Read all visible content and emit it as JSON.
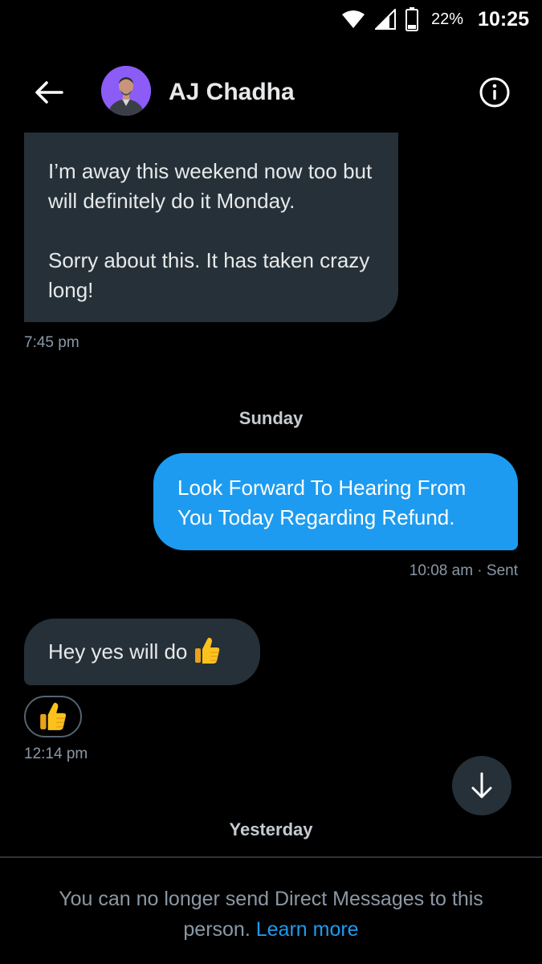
{
  "status_bar": {
    "battery_percent": "22%",
    "time": "10:25",
    "icons": [
      "wifi-icon",
      "cell-signal-icon",
      "battery-icon"
    ]
  },
  "header": {
    "contact_name": "AJ Chadha",
    "back_icon": "arrow-left-icon",
    "info_icon": "info-circle-icon"
  },
  "messages": [
    {
      "direction": "incoming",
      "paragraphs": [
        "I’m away this weekend now too but will definitely do it Monday.",
        "Sorry about this. It has taken crazy long!"
      ],
      "time": "7:45 pm"
    },
    {
      "type": "day_separator",
      "label": "Sunday"
    },
    {
      "direction": "outgoing",
      "text": "Look Forward To Hearing From You Today Regarding Refund.",
      "time": "10:08 am · Sent"
    },
    {
      "direction": "incoming",
      "text": "Hey yes will do",
      "emoji": "thumbs-up",
      "reaction": "thumbs-up",
      "time": "12:14 pm"
    },
    {
      "type": "day_separator",
      "label": "Yesterday"
    }
  ],
  "scroll_button_icon": "arrow-down-icon",
  "footer": {
    "notice": "You can no longer send Direct Messages to this person.",
    "link": "Learn more"
  },
  "colors": {
    "background": "#000000",
    "incoming_bubble": "#253038",
    "outgoing_bubble": "#1d9bf0",
    "link": "#1d9bf0",
    "muted_text": "#8b98a5"
  }
}
